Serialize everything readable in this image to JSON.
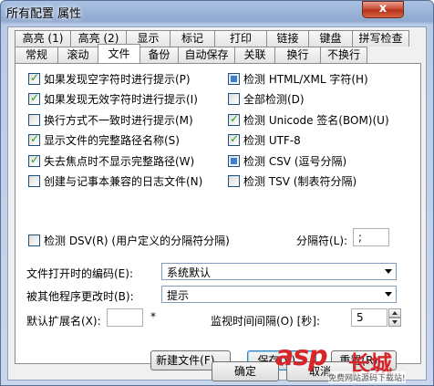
{
  "window": {
    "title": "所有配置 属性",
    "close_glyph": "x"
  },
  "tabs_row1": [
    "高亮 (1)",
    "高亮 (2)",
    "显示",
    "标记",
    "打印",
    "链接",
    "键盘",
    "拼写检查"
  ],
  "tabs_row2": [
    "常规",
    "滚动",
    "文件",
    "备份",
    "自动保存",
    "关联",
    "换行",
    "不换行"
  ],
  "active_tab": "文件",
  "left_options": [
    {
      "label": "如果发现空字符时进行提示(P)",
      "state": "checked"
    },
    {
      "label": "如果发现无效字符时进行提示(I)",
      "state": "checked"
    },
    {
      "label": "换行方式不一致时进行提示(M)",
      "state": "unchecked"
    },
    {
      "label": "显示文件的完整路径名称(S)",
      "state": "checked"
    },
    {
      "label": "失去焦点时不显示完整路径(W)",
      "state": "checked"
    },
    {
      "label": "创建与记事本兼容的日志文件(N)",
      "state": "unchecked"
    },
    {
      "label": "检测 DSV(R) (用户定义的分隔符分隔)",
      "state": "unchecked"
    }
  ],
  "right_options": [
    {
      "label": "检测 HTML/XML 字符(H)",
      "state": "indeterminate"
    },
    {
      "label": "全部检测(D)",
      "state": "unchecked"
    },
    {
      "label": "检测 Unicode 签名(BOM)(U)",
      "state": "checked"
    },
    {
      "label": "检测 UTF-8",
      "state": "checked"
    },
    {
      "label": "检测 CSV (逗号分隔)",
      "state": "indeterminate"
    },
    {
      "label": "检测 TSV (制表符分隔)",
      "state": "unchecked"
    }
  ],
  "delimiter": {
    "label": "分隔符(L):",
    "value": ";"
  },
  "encoding": {
    "label": "文件打开时的编码(E):",
    "value": "系统默认"
  },
  "modified_by_other": {
    "label": "被其他程序更改时(B):",
    "value": "提示"
  },
  "default_ext": {
    "label": "默认扩展名(X):",
    "value": "",
    "suffix": "*"
  },
  "monitor_interval": {
    "label": "监视时间间隔(O) [秒]:",
    "value": "5"
  },
  "panel_buttons": {
    "new_file": "新建文件(F)...",
    "save": "保存(V)...",
    "reset": "重置(R)..."
  },
  "dialog_buttons": {
    "ok": "确定",
    "cancel": "取消"
  },
  "watermark": {
    "brand": "asp",
    "cn": "长城",
    "url": "免费网站源码下载站!"
  }
}
